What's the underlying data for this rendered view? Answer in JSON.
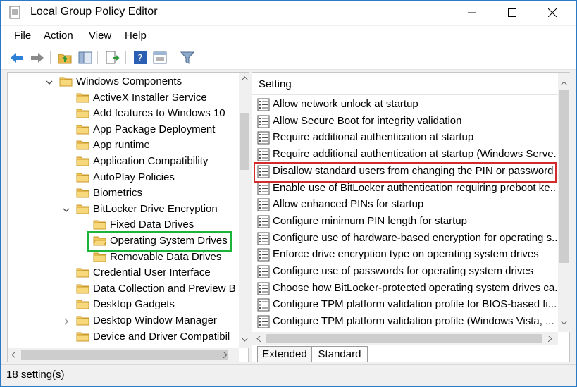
{
  "window": {
    "title": "Local Group Policy Editor"
  },
  "menu": [
    "File",
    "Action",
    "View",
    "Help"
  ],
  "toolbar_icons": [
    "back-arrow-icon",
    "forward-arrow-icon",
    "up-folder-icon",
    "show-hide-tree-icon",
    "export-list-icon",
    "help-icon",
    "properties-icon",
    "filter-icon"
  ],
  "tree": {
    "items": [
      {
        "label": "Windows Components",
        "expanded": true,
        "depth": 0
      },
      {
        "label": "ActiveX Installer Service",
        "depth": 1
      },
      {
        "label": "Add features to Windows 10",
        "depth": 1
      },
      {
        "label": "App Package Deployment",
        "depth": 1
      },
      {
        "label": "App runtime",
        "depth": 1
      },
      {
        "label": "Application Compatibility",
        "depth": 1
      },
      {
        "label": "AutoPlay Policies",
        "depth": 1
      },
      {
        "label": "Biometrics",
        "depth": 1
      },
      {
        "label": "BitLocker Drive Encryption",
        "expanded": true,
        "depth": 1
      },
      {
        "label": "Fixed Data Drives",
        "depth": 2
      },
      {
        "label": "Operating System Drives",
        "depth": 2,
        "selected": true
      },
      {
        "label": "Removable Data Drives",
        "depth": 2
      },
      {
        "label": "Credential User Interface",
        "depth": 1
      },
      {
        "label": "Data Collection and Preview B",
        "depth": 1
      },
      {
        "label": "Desktop Gadgets",
        "depth": 1
      },
      {
        "label": "Desktop Window Manager",
        "depth": 1,
        "collapsed": true
      },
      {
        "label": "Device and Driver Compatibil",
        "depth": 1
      }
    ]
  },
  "settings": {
    "column_header": "Setting",
    "rows": [
      "Allow network unlock at startup",
      "Allow Secure Boot for integrity validation",
      "Require additional authentication at startup",
      "Require additional authentication at startup (Windows Serve...",
      "Disallow standard users from changing the PIN or password",
      "Enable use of BitLocker authentication requiring preboot ke...",
      "Allow enhanced PINs for startup",
      "Configure minimum PIN length for startup",
      "Configure use of hardware-based encryption for operating s...",
      "Enforce drive encryption type on operating system drives",
      "Configure use of passwords for operating system drives",
      "Choose how BitLocker-protected operating system drives ca...",
      "Configure TPM platform validation profile for BIOS-based fi...",
      "Configure TPM platform validation profile (Windows Vista, ..."
    ],
    "highlighted_index": 4
  },
  "tabs": [
    "Extended",
    "Standard"
  ],
  "active_tab": "Standard",
  "status": "18 setting(s)",
  "colors": {
    "green_highlight": "#1bb33a",
    "red_highlight": "#d12b2b",
    "folder": "#e8b84a"
  }
}
